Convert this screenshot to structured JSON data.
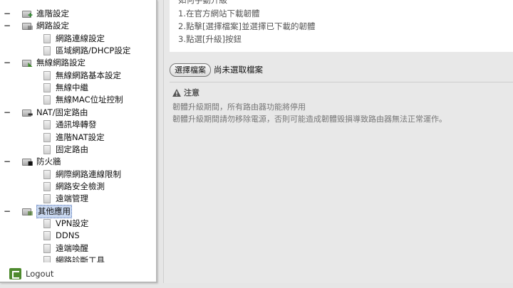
{
  "tree": {
    "categories": [
      {
        "label": "進階設定",
        "toggle": "−",
        "badge": "✚",
        "badge_color": "#2e8b2e",
        "children": []
      },
      {
        "label": "網路設定",
        "toggle": "−",
        "badge": "▤",
        "badge_color": "#555555",
        "children": [
          "網路連線設定",
          "區域網路/DHCP設定"
        ]
      },
      {
        "label": "無線網路設定",
        "toggle": "−",
        "badge": "◣",
        "badge_color": "#3d8a2a",
        "children": [
          "無線網路基本設定",
          "無線中繼",
          "無線MAC位址控制"
        ]
      },
      {
        "label": "NAT/固定路由",
        "toggle": "−",
        "badge": "▬",
        "badge_color": "#333333",
        "children": [
          "通訊埠轉發",
          "進階NAT設定",
          "固定路由"
        ]
      },
      {
        "label": "防火牆",
        "toggle": "−",
        "badge": "■",
        "badge_color": "#111111",
        "children": [
          "網際網路連線限制",
          "網路安全檢測",
          "遠端管理"
        ]
      },
      {
        "label": "其他應用",
        "toggle": "−",
        "badge": "▦",
        "badge_color": "#4a7a2a",
        "selected": true,
        "children": [
          "VPN設定",
          "DDNS",
          "遠端喚醒",
          "網路診斷工具"
        ]
      }
    ]
  },
  "logout": {
    "label": "Logout"
  },
  "instructions": {
    "heading": "如何手動升級",
    "steps": [
      "1.在官方網站下載韌體",
      "2.點擊[選擇檔案]並選擇已下載的韌體",
      "3.點選[升級]按鈕"
    ]
  },
  "file": {
    "button_label": "選擇檔案",
    "status": "尚未選取檔案"
  },
  "warning": {
    "title": "注意",
    "lines": [
      "韌體升級期間，所有路由器功能將停用",
      "韌體升級期間請勿移除電源，否則可能造成韌體毀損導致路由器無法正常運作。"
    ]
  }
}
